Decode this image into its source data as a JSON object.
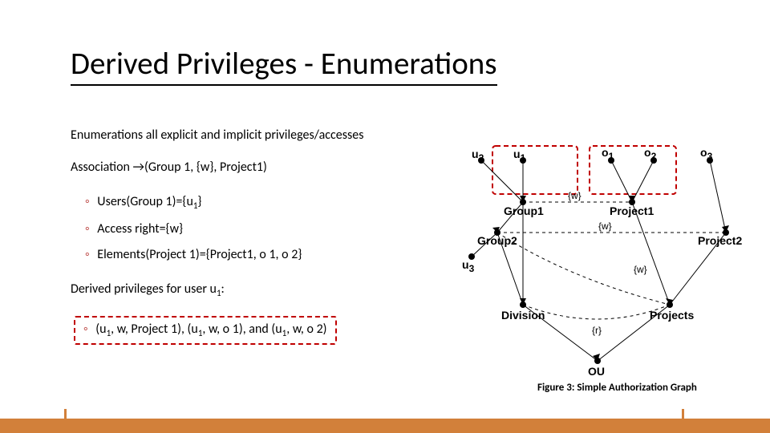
{
  "title": "Derived Privileges - Enumerations",
  "body": {
    "p1": "Enumerations all explicit and implicit privileges/accesses",
    "p2": "Association →(Group 1, {w}, Project1)",
    "b1_pre": "Users(Group 1)={u",
    "b1_sub": "1",
    "b1_post": "}",
    "b2": "Access right={w}",
    "b3": "Elements(Project 1)={Project1, o 1, o 2}",
    "p3_pre": "Derived privileges for user u",
    "p3_sub": "1",
    "p3_post": ":",
    "b4_a": "(u",
    "b4_b": ", w, Project 1), (u",
    "b4_c": ", w, o 1), and (u",
    "b4_d": ", w, o 2)",
    "b4_sub": "1"
  },
  "fig": {
    "caption": "Figure 3: Simple Authorization Graph",
    "u1": "u",
    "u1s": "1",
    "u2": "u",
    "u2s": "2",
    "u3": "u",
    "u3s": "3",
    "o1": "o",
    "o1s": "1",
    "o2": "o",
    "o2s": "2",
    "o3": "o",
    "o3s": "3",
    "group1": "Group1",
    "group2": "Group2",
    "project1": "Project1",
    "project2": "Project2",
    "division": "Division",
    "projects": "Projects",
    "ou": "OU",
    "w": "{w}",
    "r": "{r}"
  }
}
